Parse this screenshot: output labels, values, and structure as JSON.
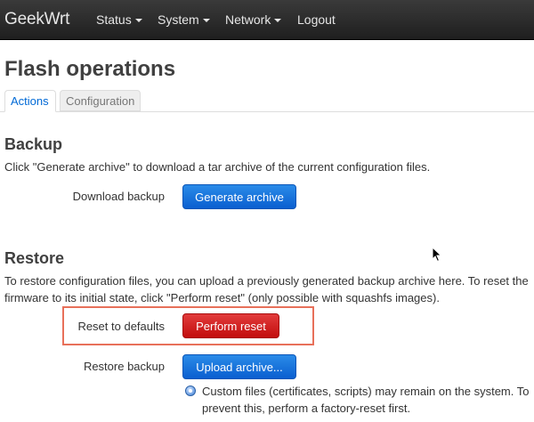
{
  "navbar": {
    "brand": "GeekWrt",
    "items": [
      {
        "label": "Status",
        "has_dropdown": true
      },
      {
        "label": "System",
        "has_dropdown": true
      },
      {
        "label": "Network",
        "has_dropdown": true
      },
      {
        "label": "Logout",
        "has_dropdown": false
      }
    ]
  },
  "page": {
    "title": "Flash operations",
    "tabs": [
      {
        "label": "Actions",
        "active": true
      },
      {
        "label": "Configuration",
        "active": false
      }
    ]
  },
  "backup": {
    "title": "Backup",
    "description": "Click \"Generate archive\" to download a tar archive of the current configuration files.",
    "download_label": "Download backup",
    "generate_button": "Generate archive"
  },
  "restore": {
    "title": "Restore",
    "description_line1": "To restore configuration files, you can upload a previously generated backup archive here. To reset the",
    "description_line2": "firmware to its initial state, click \"Perform reset\" (only possible with squashfs images).",
    "reset_label": "Reset to defaults",
    "reset_button": "Perform reset",
    "restore_label": "Restore backup",
    "upload_button": "Upload archive...",
    "note_line1": "Custom files (certificates, scripts) may remain on the system. To",
    "note_line2": "prevent this, perform a factory-reset first."
  },
  "colors": {
    "navbar_bg": "#2b2b2b",
    "primary_button": "#0a6ee0",
    "danger_button": "#d21c1c",
    "highlight_border": "#e8705a",
    "active_tab_text": "#0069d6"
  }
}
